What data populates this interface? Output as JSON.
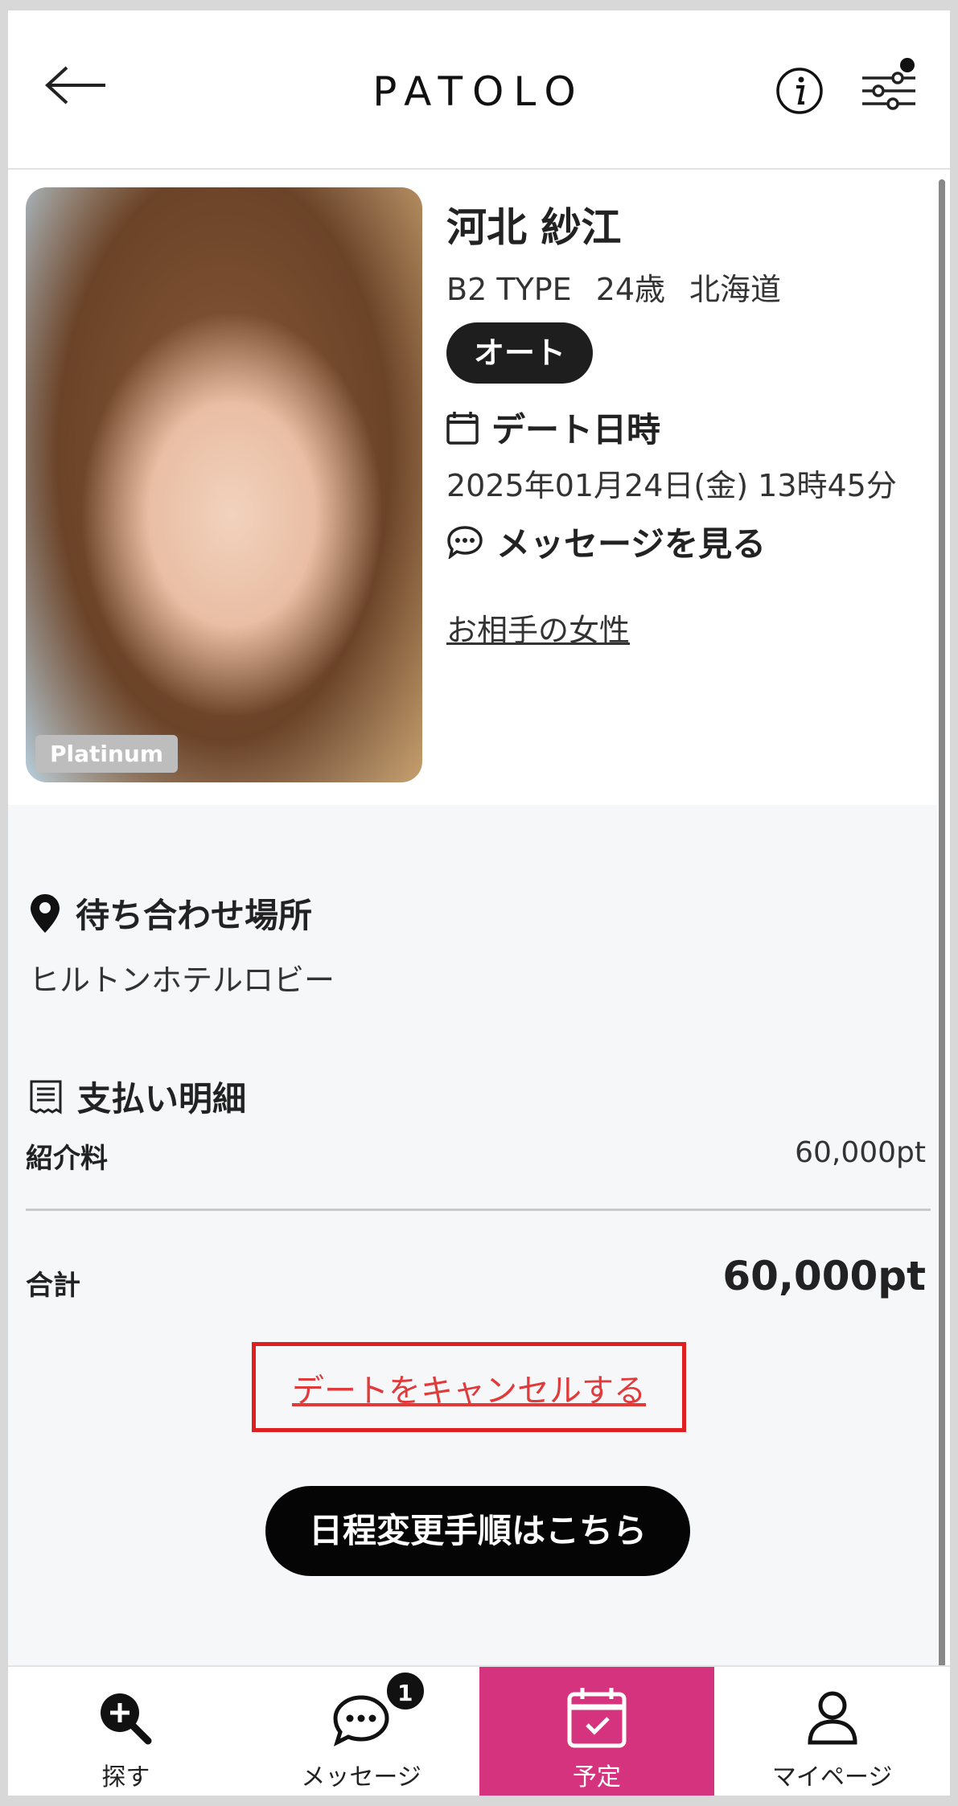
{
  "header": {
    "logo": "PATOLO",
    "back_icon": "arrow-left-icon",
    "info_icon": "info-icon",
    "filter_icon": "sliders-icon"
  },
  "profile": {
    "badge": "Platinum",
    "name": "河北 紗江",
    "type": "B2 TYPE",
    "age": "24歳",
    "region": "北海道",
    "mode_pill": "オート",
    "date_heading": "デート日時",
    "date_value": "2025年01月24日(金) 13時45分",
    "message_link": "メッセージを見る",
    "partner_link": "お相手の女性"
  },
  "meeting": {
    "heading": "待ち合わせ場所",
    "place": "ヒルトンホテルロビー"
  },
  "payment": {
    "heading": "支払い明細",
    "fee_label": "紹介料",
    "fee_value": "60,000pt",
    "total_label": "合計",
    "total_value": "60,000pt"
  },
  "actions": {
    "cancel": "デートをキャンセルする",
    "reschedule": "日程変更手順はこちら"
  },
  "nav": {
    "items": [
      {
        "label": "探す",
        "icon": "search-plus-icon"
      },
      {
        "label": "メッセージ",
        "icon": "chat-icon",
        "badge": "1"
      },
      {
        "label": "予定",
        "icon": "calendar-check-icon"
      },
      {
        "label": "マイページ",
        "icon": "user-icon"
      }
    ]
  },
  "colors": {
    "accent": "#d6337f",
    "highlight_border": "#e02020",
    "cancel_text": "#e03a3a"
  }
}
